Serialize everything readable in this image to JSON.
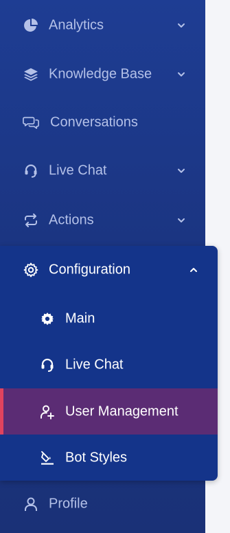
{
  "colors": {
    "sidebar_bg": "#1b3582",
    "panel_bg": "#14348a",
    "active_bg": "#5b2c74",
    "active_accent": "#e0435e",
    "muted_text": "#b4c1e8",
    "page_bg": "#f4f5f9"
  },
  "nav": {
    "items": [
      {
        "label": "Analytics",
        "icon": "pie-chart-icon",
        "has_chevron": true
      },
      {
        "label": "Knowledge Base",
        "icon": "layers-icon",
        "has_chevron": true
      },
      {
        "label": "Conversations",
        "icon": "chat-bubbles-icon",
        "has_chevron": false
      },
      {
        "label": "Live Chat",
        "icon": "headset-icon",
        "has_chevron": true
      },
      {
        "label": "Actions",
        "icon": "swap-arrows-icon",
        "has_chevron": true
      }
    ],
    "configuration": {
      "label": "Configuration",
      "icon": "gear-icon",
      "expanded": true,
      "children": [
        {
          "label": "Main",
          "icon": "cog-solid-icon",
          "active": false
        },
        {
          "label": "Live Chat",
          "icon": "headset-icon",
          "active": false
        },
        {
          "label": "User Management",
          "icon": "user-add-icon",
          "active": true
        },
        {
          "label": "Bot Styles",
          "icon": "paint-bucket-icon",
          "active": false
        }
      ]
    },
    "profile": {
      "label": "Profile",
      "icon": "user-icon"
    }
  }
}
